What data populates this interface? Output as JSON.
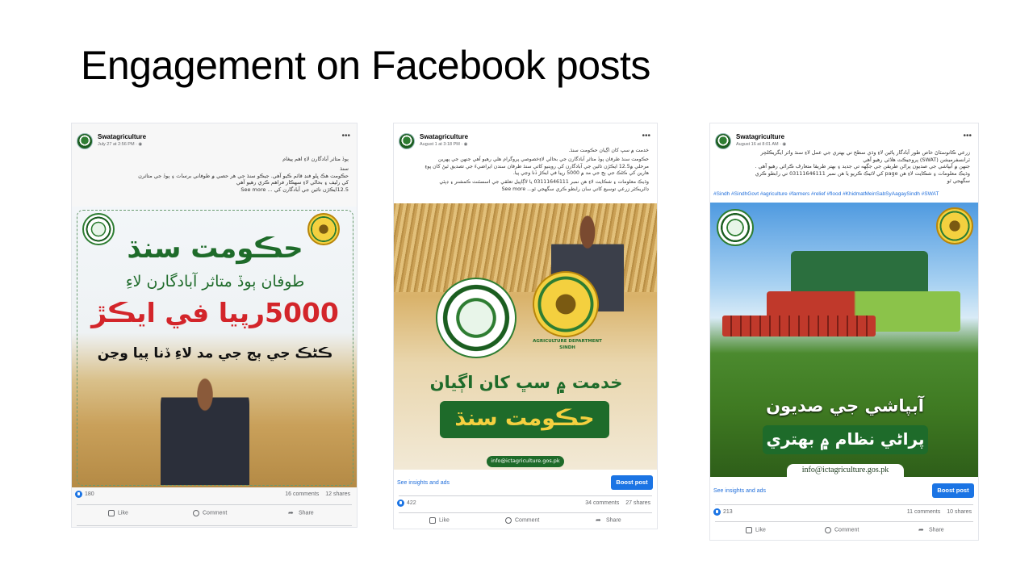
{
  "slide": {
    "title": "Engagement on Facebook posts"
  },
  "colors": {
    "facebook_blue": "#1b74e4",
    "link_blue": "#216fdb",
    "sindh_green": "#1e6b2a",
    "headline_red": "#d3252a"
  },
  "posts": [
    {
      "page_name": "Swatagriculture",
      "date": "July 27 at 2:56 PM · ",
      "caption_lines": [
        "ٻوڏ متاثر آبادگارن لاءِ اهم پيغام",
        "سنڌ",
        "حڪومت هڪ ڀلو فنڊ قائم ڪيو آهي. جيڪو سنڌ جي هر حصي ۾ طوفاني برسات ۽ ٻوڏ جي متاثرن",
        "کي رليف ۽ بحالي لاءِ سهڪار فراهم ڪري رهيو آهي",
        "12.5ايڪڙن تائين جي آبادگارن کي ... See more"
      ],
      "image_text": {
        "line1": "حڪومت سنڌ",
        "line2": "طوفان ٻوڏ متاثر آبادگارن لاءِ",
        "line3": "5000رپيا في ايڪڙ",
        "line4": "ڪڻڪ جي ٻج جي مد لاءِ ڏنا پيا وڃن"
      },
      "stats": {
        "likes": "180",
        "comments": "16 comments",
        "shares": "12 shares"
      },
      "actions": {
        "like": "Like",
        "comment": "Comment",
        "share": "Share"
      }
    },
    {
      "page_name": "Swatagriculture",
      "date": "August 1 at 3:18 PM · ",
      "caption_lines": [
        "خدمت ۾ سڀ کان اڳيان حڪومت سنڌ.",
        "حڪومت سنڌ طرفان ٻوڏ متاثر آبادگارن جي بحالي لاءِخصوصي پروگرام هلي رهيو آهي جنهن جي پهرين",
        "مرحلي ۾12.5 ايڪڙن تائين جي آبادگارن کي روينيو کاتي سنڌ طرفان سندن ايراضيءَ جي تصديق ٿيڻ کان پوءِ",
        "هارين کي ڪڻڪ جي ٻج جي مد ۾ 5000 رپيا في ايڪڙ ڏنا وڃي پيا.",
        "وڌيڪ معلومات ۽ شڪايت لاءِ هن نمبر 03111646111 يا لاڳاپيل تعلقي جي اسسٽنٽ ڪمشنر ۽ ڊپٽي",
        "ڊائريڪٽر زرعي توسيع کاتي سان رابطو ڪري سگهجي ٿو... See more"
      ],
      "image_text": {
        "dept": "AGRICULTURE DEPARTMENT",
        "province": "SINDH",
        "line1": "خدمت ۾ سڀ کان اڳيان",
        "line2": "حڪومت سنڌ",
        "email": "info@ictagriculture.gos.pk"
      },
      "insights": {
        "link": "See insights and ads",
        "boost": "Boost post"
      },
      "stats": {
        "likes": "422",
        "comments": "34 comments",
        "shares": "27 shares"
      },
      "actions": {
        "like": "Like",
        "comment": "Comment",
        "share": "Share"
      }
    },
    {
      "page_name": "Swatagriculture",
      "date": "August 16 at 8:01 AM · ",
      "caption_lines": [
        "زرعي ڪانوسٽاڻ خاص طور آبادگار پاڻين لاءِ وڌي سطح تي بهتري جي عمل لاءِ سنڌ واٽر ايگريڪلچر",
        "ٽرانسفرميشن (SWAT) پروجيڪٽ هلائي رهيو آهي",
        "جنهن ۾ آبپاشي جي صديون پراڻن طريقن جي جڳهه تي جديد ۽ بهتر طريقا متعارف ڪرائي رهيو آهي .",
        "وڌيڪ معلومات ۽ شڪايت لاءِ هن page کي لائيڪ ڪريو يا هن نمبر 03111646111 تي رابطو ڪري",
        "سگهجي ٿو"
      ],
      "hashtags": "#Sindh #SindhGovt #agriculture #farmers #relief #flood #KhidmatMeinSabSyAagaySindh #SWAT",
      "image_text": {
        "line1": "آبپاشي جي صديون",
        "line2": "پراڻي نظام ۾ بهتري",
        "email": "info@ictagriculture.gos.pk"
      },
      "insights": {
        "link": "See insights and ads",
        "boost": "Boost post"
      },
      "stats": {
        "likes": "213",
        "comments": "11 comments",
        "shares": "10 shares"
      },
      "actions": {
        "like": "Like",
        "comment": "Comment",
        "share": "Share"
      }
    }
  ]
}
